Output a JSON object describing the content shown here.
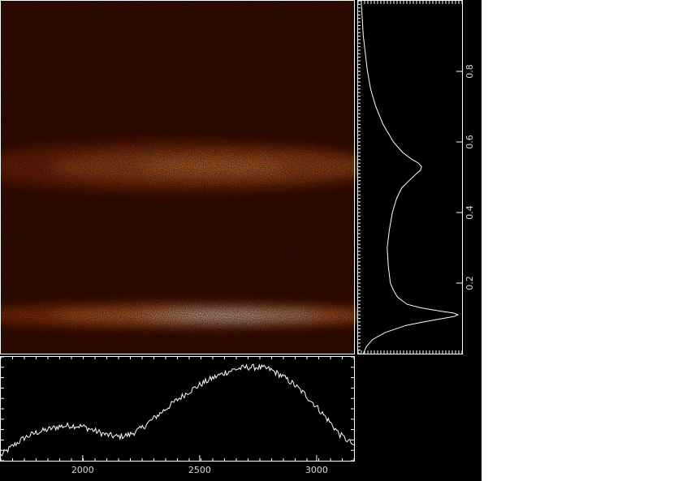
{
  "figure": {
    "background": "#000000",
    "colormap": [
      "#000000",
      "#3a0500",
      "#8a1c00",
      "#d94a10",
      "#ff8a3a",
      "#ffd6a8",
      "#ffffff"
    ],
    "line_color": "#ffffff"
  },
  "chart_data": [
    {
      "type": "heatmap",
      "title": "",
      "xlabel": "",
      "ylabel": "",
      "x_range": [
        1650,
        3160
      ],
      "y_range": [
        0,
        1.0
      ],
      "bands": [
        {
          "y_center": 0.11,
          "width": 0.022,
          "intensity": 1.0
        },
        {
          "y_center": 0.53,
          "width": 0.045,
          "intensity": 0.52
        }
      ],
      "x_profile_peak": 2700
    },
    {
      "type": "line",
      "title": "",
      "orientation": "vertical",
      "ylabel": "",
      "y_ticks": [
        "0.2",
        "0.4",
        "0.6",
        "0.8"
      ],
      "y_tick_values": [
        0.2,
        0.4,
        0.6,
        0.8
      ],
      "y_range": [
        0,
        1.0
      ],
      "series": [
        {
          "y": [
            0.0,
            0.02,
            0.04,
            0.06,
            0.08,
            0.09,
            0.1,
            0.105,
            0.11,
            0.115,
            0.12,
            0.13,
            0.14,
            0.16,
            0.18,
            0.2,
            0.25,
            0.3,
            0.35,
            0.4,
            0.44,
            0.47,
            0.49,
            0.51,
            0.52,
            0.53,
            0.54,
            0.55,
            0.57,
            0.6,
            0.65,
            0.7,
            0.75,
            0.8,
            0.9,
            1.0
          ],
          "x": [
            0.05,
            0.08,
            0.14,
            0.26,
            0.46,
            0.63,
            0.82,
            0.92,
            0.96,
            0.92,
            0.8,
            0.6,
            0.47,
            0.38,
            0.34,
            0.31,
            0.29,
            0.28,
            0.3,
            0.33,
            0.37,
            0.42,
            0.49,
            0.56,
            0.6,
            0.61,
            0.58,
            0.52,
            0.43,
            0.34,
            0.24,
            0.17,
            0.12,
            0.09,
            0.05,
            0.03
          ]
        }
      ]
    },
    {
      "type": "line",
      "title": "",
      "xlabel": "",
      "x_ticks": [
        "2000",
        "2500",
        "3000"
      ],
      "x_tick_values": [
        2000,
        2500,
        3000
      ],
      "x_range": [
        1650,
        3160
      ],
      "series": [
        {
          "x": [
            1650,
            1700,
            1750,
            1800,
            1850,
            1900,
            1950,
            2000,
            2050,
            2100,
            2150,
            2200,
            2250,
            2300,
            2350,
            2400,
            2450,
            2500,
            2550,
            2600,
            2650,
            2700,
            2750,
            2800,
            2850,
            2900,
            2950,
            3000,
            3050,
            3100,
            3160
          ],
          "y": [
            0.05,
            0.14,
            0.22,
            0.27,
            0.3,
            0.33,
            0.34,
            0.33,
            0.29,
            0.25,
            0.23,
            0.25,
            0.31,
            0.4,
            0.49,
            0.58,
            0.66,
            0.73,
            0.79,
            0.84,
            0.88,
            0.9,
            0.9,
            0.88,
            0.82,
            0.74,
            0.64,
            0.52,
            0.39,
            0.25,
            0.15
          ]
        }
      ]
    }
  ]
}
